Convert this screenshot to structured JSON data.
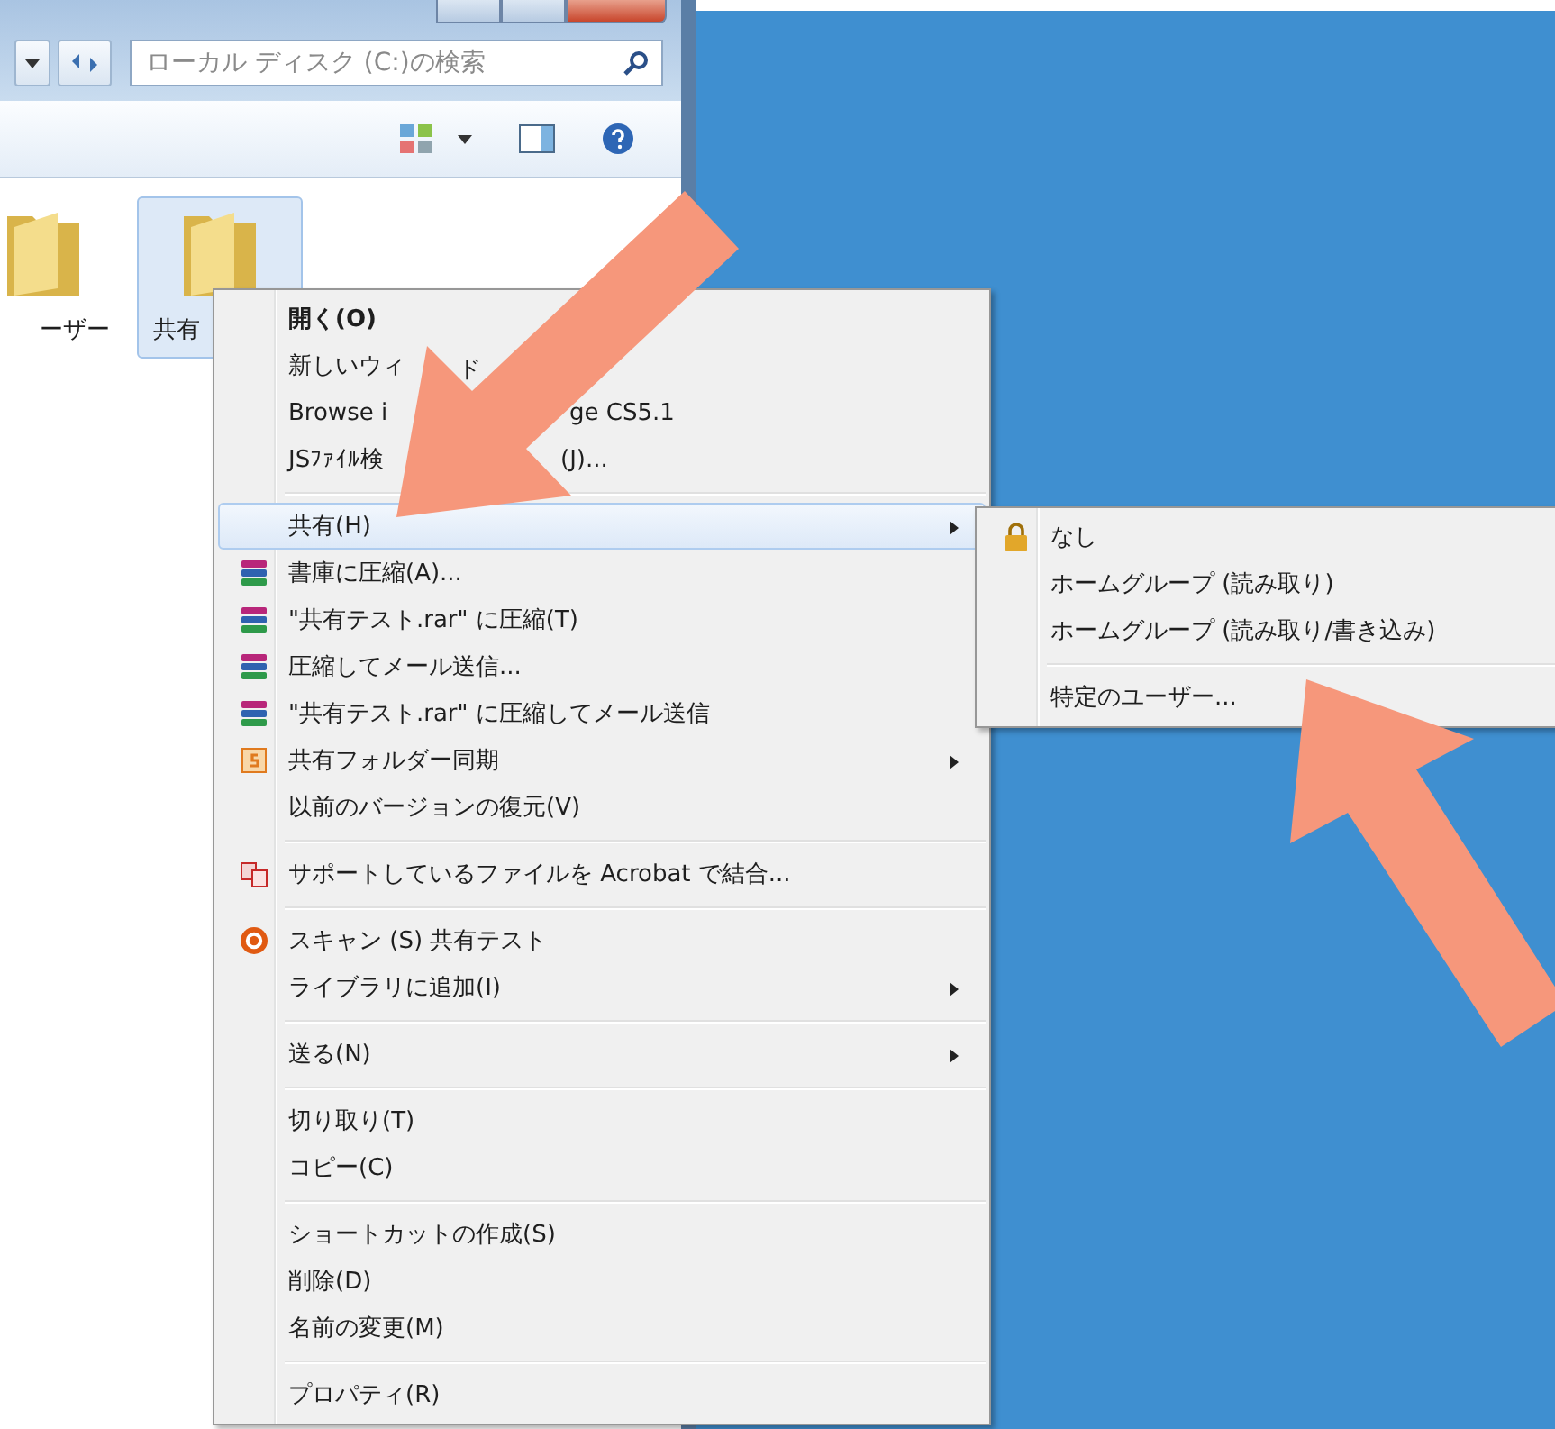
{
  "explorer": {
    "search": {
      "placeholder": "ローカル ディスク (C:)の検索"
    },
    "items": [
      {
        "label": "ーザー",
        "selected": false
      },
      {
        "label": "共有",
        "selected": true
      }
    ]
  },
  "context_menu": {
    "items": [
      {
        "kind": "item",
        "label": "開く(O)",
        "default": true,
        "selected": false,
        "submenu": false
      },
      {
        "kind": "item",
        "label": "新しいウィ",
        "label_after": "ド",
        "default": false,
        "selected": false,
        "submenu": false
      },
      {
        "kind": "item",
        "label": "Browse i",
        "label_after": "ge CS5.1",
        "default": false,
        "selected": false,
        "submenu": false
      },
      {
        "kind": "item",
        "label": "JSﾌｧｲﾙ検",
        "label_after": "(J)...",
        "default": false,
        "selected": false,
        "submenu": false
      },
      {
        "kind": "separator"
      },
      {
        "kind": "item",
        "label": "共有(H)",
        "default": false,
        "selected": true,
        "submenu": true
      },
      {
        "kind": "archive",
        "label": "書庫に圧縮(A)...",
        "default": false,
        "selected": false,
        "submenu": false
      },
      {
        "kind": "archive",
        "label": "\"共有テスト.rar\" に圧縮(T)",
        "default": false,
        "selected": false,
        "submenu": false
      },
      {
        "kind": "archive",
        "label": "圧縮してメール送信...",
        "default": false,
        "selected": false,
        "submenu": false
      },
      {
        "kind": "archive",
        "label": "\"共有テスト.rar\" に圧縮してメール送信",
        "default": false,
        "selected": false,
        "submenu": false
      },
      {
        "kind": "sync",
        "label": "共有フォルダー同期",
        "default": false,
        "selected": false,
        "submenu": true
      },
      {
        "kind": "item",
        "label": "以前のバージョンの復元(V)",
        "default": false,
        "selected": false,
        "submenu": false
      },
      {
        "kind": "separator"
      },
      {
        "kind": "combine",
        "label": "サポートしているファイルを Acrobat で結合...",
        "default": false,
        "selected": false,
        "submenu": false
      },
      {
        "kind": "separator"
      },
      {
        "kind": "scan",
        "label": "スキャン (S) 共有テスト",
        "default": false,
        "selected": false,
        "submenu": false
      },
      {
        "kind": "item",
        "label": "ライブラリに追加(I)",
        "default": false,
        "selected": false,
        "submenu": true
      },
      {
        "kind": "separator"
      },
      {
        "kind": "item",
        "label": "送る(N)",
        "default": false,
        "selected": false,
        "submenu": true
      },
      {
        "kind": "separator"
      },
      {
        "kind": "item",
        "label": "切り取り(T)",
        "default": false,
        "selected": false,
        "submenu": false
      },
      {
        "kind": "item",
        "label": "コピー(C)",
        "default": false,
        "selected": false,
        "submenu": false
      },
      {
        "kind": "separator"
      },
      {
        "kind": "item",
        "label": "ショートカットの作成(S)",
        "default": false,
        "selected": false,
        "submenu": false
      },
      {
        "kind": "item",
        "label": "削除(D)",
        "default": false,
        "selected": false,
        "submenu": false
      },
      {
        "kind": "item",
        "label": "名前の変更(M)",
        "default": false,
        "selected": false,
        "submenu": false
      },
      {
        "kind": "separator"
      },
      {
        "kind": "item",
        "label": "プロパティ(R)",
        "default": false,
        "selected": false,
        "submenu": false
      }
    ]
  },
  "share_submenu": {
    "items": [
      {
        "kind": "lock",
        "label": "なし"
      },
      {
        "kind": "item",
        "label": "ホームグループ (読み取り)"
      },
      {
        "kind": "item",
        "label": "ホームグループ (読み取り/書き込み)"
      },
      {
        "kind": "separator"
      },
      {
        "kind": "item",
        "label": "特定のユーザー..."
      }
    ]
  }
}
